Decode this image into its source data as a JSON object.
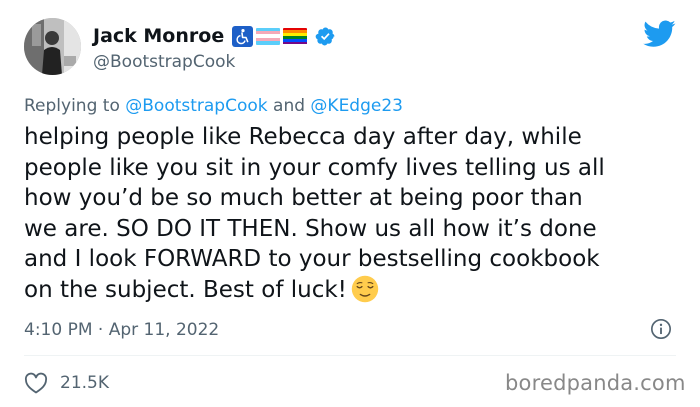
{
  "author": {
    "display_name": "Jack Monroe",
    "handle": "@BootstrapCook",
    "badges": [
      "wheelchair-accessibility-icon",
      "transgender-flag-icon",
      "rainbow-flag-icon",
      "verified-badge-icon"
    ]
  },
  "reply": {
    "prefix": "Replying to",
    "mention_1": "@BootstrapCook",
    "joiner": "and",
    "mention_2": "@KEdge23"
  },
  "body": {
    "lines": [
      "helping people like Rebecca day after day, while",
      "people like you sit in your comfy lives telling us all",
      "how you’d be so much better at being poor than",
      "we are. SO DO IT THEN. Show us all how it’s done",
      "and I look FORWARD to your bestselling cookbook",
      "on the subject. Best of luck!"
    ],
    "emoji": "relieved-face-emoji"
  },
  "meta": {
    "timestamp": "4:10 PM · Apr 11, 2022",
    "like_count": "21.5K"
  },
  "watermark": "boredpanda.com",
  "colors": {
    "text": "#0f1419",
    "secondary": "#536471",
    "accent": "#1d9bf0",
    "verified": "#1d9bf0",
    "accessibility": "#1d5fc7"
  }
}
